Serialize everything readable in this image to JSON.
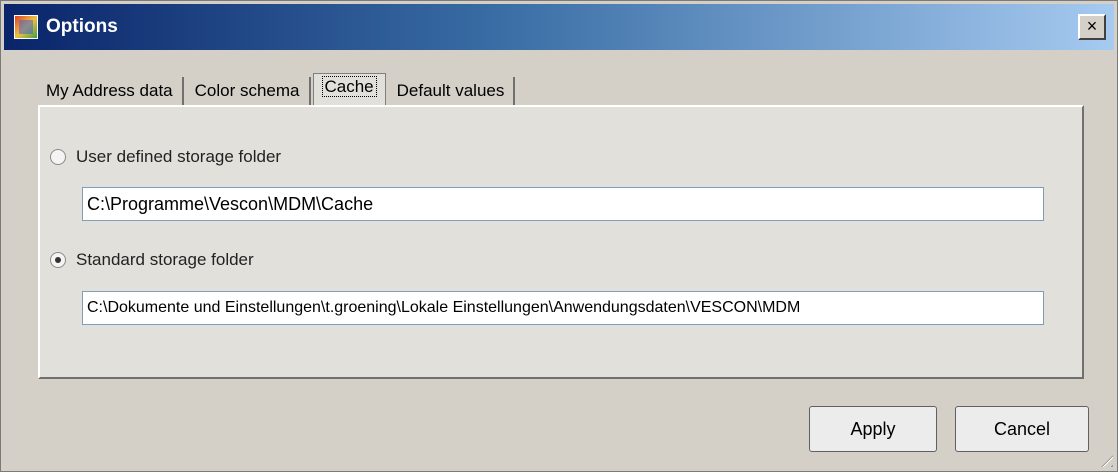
{
  "window": {
    "title": "Options",
    "close_label": "×"
  },
  "tabs": [
    {
      "label": "My Address data"
    },
    {
      "label": "Color schema"
    },
    {
      "label": "Cache",
      "active": true
    },
    {
      "label": "Default values"
    }
  ],
  "cache": {
    "user_defined": {
      "label": "User defined storage folder",
      "checked": false,
      "value": "C:\\Programme\\Vescon\\MDM\\Cache"
    },
    "standard": {
      "label": "Standard storage folder",
      "checked": true,
      "value": "C:\\Dokumente und Einstellungen\\t.groening\\Lokale Einstellungen\\Anwendungsdaten\\VESCON\\MDM"
    }
  },
  "buttons": {
    "apply": "Apply",
    "cancel": "Cancel"
  },
  "icons": {
    "app": "options-app-icon",
    "close": "close-icon",
    "resize": "resize-grip-icon"
  },
  "colors": {
    "titlebar_start": "#0a246a",
    "titlebar_end": "#a6caf0",
    "face": "#d4d0c8"
  }
}
